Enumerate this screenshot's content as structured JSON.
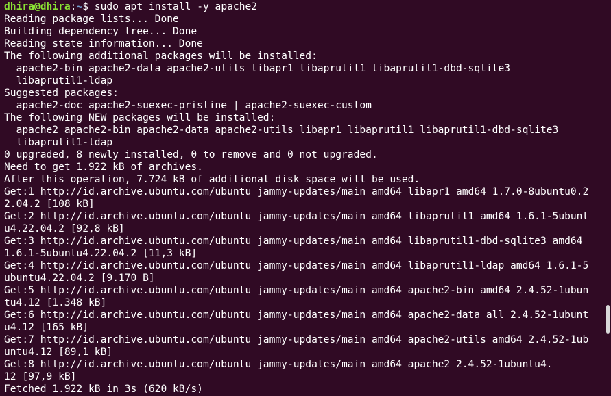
{
  "prompt": {
    "user_host": "dhira@dhira",
    "separator": ":",
    "path": "~",
    "symbol": "$ ",
    "command": "sudo apt install -y apache2"
  },
  "output_lines": [
    "Reading package lists... Done",
    "Building dependency tree... Done",
    "Reading state information... Done",
    "The following additional packages will be installed:",
    "  apache2-bin apache2-data apache2-utils libapr1 libaprutil1 libaprutil1-dbd-sqlite3",
    "  libaprutil1-ldap",
    "Suggested packages:",
    "  apache2-doc apache2-suexec-pristine | apache2-suexec-custom",
    "The following NEW packages will be installed:",
    "  apache2 apache2-bin apache2-data apache2-utils libapr1 libaprutil1 libaprutil1-dbd-sqlite3",
    "  libaprutil1-ldap",
    "0 upgraded, 8 newly installed, 0 to remove and 0 not upgraded.",
    "Need to get 1.922 kB of archives.",
    "After this operation, 7.724 kB of additional disk space will be used.",
    "Get:1 http://id.archive.ubuntu.com/ubuntu jammy-updates/main amd64 libapr1 amd64 1.7.0-8ubuntu0.2",
    "2.04.2 [108 kB]",
    "Get:2 http://id.archive.ubuntu.com/ubuntu jammy-updates/main amd64 libaprutil1 amd64 1.6.1-5ubunt",
    "u4.22.04.2 [92,8 kB]",
    "Get:3 http://id.archive.ubuntu.com/ubuntu jammy-updates/main amd64 libaprutil1-dbd-sqlite3 amd64",
    "1.6.1-5ubuntu4.22.04.2 [11,3 kB]",
    "Get:4 http://id.archive.ubuntu.com/ubuntu jammy-updates/main amd64 libaprutil1-ldap amd64 1.6.1-5",
    "ubuntu4.22.04.2 [9.170 B]",
    "Get:5 http://id.archive.ubuntu.com/ubuntu jammy-updates/main amd64 apache2-bin amd64 2.4.52-1ubun",
    "tu4.12 [1.348 kB]",
    "Get:6 http://id.archive.ubuntu.com/ubuntu jammy-updates/main amd64 apache2-data all 2.4.52-1ubunt",
    "u4.12 [165 kB]",
    "Get:7 http://id.archive.ubuntu.com/ubuntu jammy-updates/main amd64 apache2-utils amd64 2.4.52-1ub",
    "untu4.12 [89,1 kB]",
    "Get:8 http://id.archive.ubuntu.com/ubuntu jammy-updates/main amd64 apache2 2.4.52-1ubuntu4.",
    "12 [97,9 kB]",
    "Fetched 1.922 kB in 3s (620 kB/s)"
  ],
  "colors": {
    "background": "#300a24",
    "text": "#ffffff",
    "prompt_user": "#8ae234",
    "prompt_path": "#729fcf",
    "scrollbar": "#d9d9d9"
  }
}
